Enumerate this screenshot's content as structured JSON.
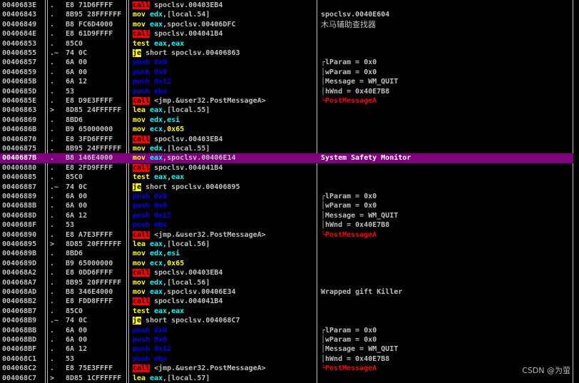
{
  "colors": {
    "background": "#000000",
    "text": "#c0c0c0",
    "selected_row": "#800080",
    "call_bg": "#ff0000",
    "call_fg": "#000000",
    "jump_bg": "#ffff00",
    "jump_fg": "#000000",
    "push": "#0000ff",
    "mov_lea": "#ffff00",
    "register": "#00ffff",
    "test": "#ffff00",
    "immediate": "#ffff00",
    "api_name": "#ff0000"
  },
  "watermark": "CSDN @为萤",
  "rows": [
    {
      "addr": "0040683E",
      "mark": ".",
      "hex": "E8 71D6FFFF",
      "mn": "call",
      "mt": "call",
      "op": "spoclsv.00403EB4",
      "cm": ""
    },
    {
      "addr": "00406843",
      "mark": ".",
      "hex": "8B95 28FFFFFF",
      "mn": "mov",
      "mt": "mov",
      "op": "edx,[local.54]",
      "cm": "spoclsv.0040E604"
    },
    {
      "addr": "00406849",
      "mark": ".",
      "hex": "B8 FC6D4000",
      "mn": "mov",
      "mt": "mov",
      "op": "eax,spoclsv.00406DFC",
      "cm": "木马辅助查找器",
      "cmt": "cn"
    },
    {
      "addr": "0040684E",
      "mark": ".",
      "hex": "E8 61D9FFFF",
      "mn": "call",
      "mt": "call",
      "op": "spoclsv.004041B4",
      "cm": ""
    },
    {
      "addr": "00406853",
      "mark": ".",
      "hex": "85C0",
      "mn": "test",
      "mt": "test",
      "op": "eax,eax",
      "cm": ""
    },
    {
      "addr": "00406855",
      "mark": ".~",
      "hex": "74 0C",
      "mn": "je",
      "mt": "jmp",
      "op": "short spoclsv.00406863",
      "cm": ""
    },
    {
      "addr": "00406857",
      "mark": ".",
      "hex": "6A 00",
      "mn": "push",
      "mt": "push",
      "op": "0x0",
      "cm": "┌lParam = 0x0"
    },
    {
      "addr": "00406859",
      "mark": ".",
      "hex": "6A 00",
      "mn": "push",
      "mt": "push",
      "op": "0x0",
      "cm": "│wParam = 0x0"
    },
    {
      "addr": "0040685B",
      "mark": ".",
      "hex": "6A 12",
      "mn": "push",
      "mt": "push",
      "op": "0x12",
      "cm": "│Message = WM_QUIT"
    },
    {
      "addr": "0040685D",
      "mark": ".",
      "hex": "53",
      "mn": "push",
      "mt": "push",
      "op": "ebx",
      "cm": "│hWnd = 0x40E7B8"
    },
    {
      "addr": "0040685E",
      "mark": ".",
      "hex": "E8 D9E3FFFF",
      "mn": "call",
      "mt": "call",
      "op": "<jmp.&user32.PostMessageA>",
      "cm": "└PostMessageA",
      "cmt": "api"
    },
    {
      "addr": "00406863",
      "mark": ">",
      "hex": "8D85 24FFFFFF",
      "mn": "lea",
      "mt": "mov",
      "op": "eax,[local.55]",
      "cm": ""
    },
    {
      "addr": "00406869",
      "mark": ".",
      "hex": "8BD6",
      "mn": "mov",
      "mt": "mov",
      "op": "edx,esi",
      "cm": ""
    },
    {
      "addr": "0040686B",
      "mark": ".",
      "hex": "B9 65000000",
      "mn": "mov",
      "mt": "mov",
      "op": "ecx,0x65",
      "cm": ""
    },
    {
      "addr": "00406870",
      "mark": ".",
      "hex": "E8 3FD6FFFF",
      "mn": "call",
      "mt": "call",
      "op": "spoclsv.00403EB4",
      "cm": ""
    },
    {
      "addr": "00406875",
      "mark": ".",
      "hex": "8B95 24FFFFFF",
      "mn": "mov",
      "mt": "mov",
      "op": "edx,[local.55]",
      "cm": ""
    },
    {
      "addr": "0040687B",
      "mark": ".",
      "hex": "B8 146E4000",
      "mn": "mov",
      "mt": "mov",
      "op": "eax,spoclsv.00406E14",
      "cm": "System Safety Monitor",
      "sel": true
    },
    {
      "addr": "00406880",
      "mark": ".",
      "hex": "E8 2FD9FFFF",
      "mn": "call",
      "mt": "call",
      "op": "spoclsv.004041B4",
      "cm": ""
    },
    {
      "addr": "00406885",
      "mark": ".",
      "hex": "85C0",
      "mn": "test",
      "mt": "test",
      "op": "eax,eax",
      "cm": ""
    },
    {
      "addr": "00406887",
      "mark": ".~",
      "hex": "74 0C",
      "mn": "je",
      "mt": "jmp",
      "op": "short spoclsv.00406895",
      "cm": ""
    },
    {
      "addr": "00406889",
      "mark": ".",
      "hex": "6A 00",
      "mn": "push",
      "mt": "push",
      "op": "0x0",
      "cm": "┌lParam = 0x0"
    },
    {
      "addr": "0040688B",
      "mark": ".",
      "hex": "6A 00",
      "mn": "push",
      "mt": "push",
      "op": "0x0",
      "cm": "│wParam = 0x0"
    },
    {
      "addr": "0040688D",
      "mark": ".",
      "hex": "6A 12",
      "mn": "push",
      "mt": "push",
      "op": "0x12",
      "cm": "│Message = WM_QUIT"
    },
    {
      "addr": "0040688F",
      "mark": ".",
      "hex": "53",
      "mn": "push",
      "mt": "push",
      "op": "ebx",
      "cm": "│hWnd = 0x40E7B8"
    },
    {
      "addr": "00406890",
      "mark": ".",
      "hex": "E8 A7E3FFFF",
      "mn": "call",
      "mt": "call",
      "op": "<jmp.&user32.PostMessageA>",
      "cm": "└PostMessageA",
      "cmt": "api"
    },
    {
      "addr": "00406895",
      "mark": ">",
      "hex": "8D85 20FFFFFF",
      "mn": "lea",
      "mt": "mov",
      "op": "eax,[local.56]",
      "cm": ""
    },
    {
      "addr": "0040689B",
      "mark": ".",
      "hex": "8BD6",
      "mn": "mov",
      "mt": "mov",
      "op": "edx,esi",
      "cm": ""
    },
    {
      "addr": "0040689D",
      "mark": ".",
      "hex": "B9 65000000",
      "mn": "mov",
      "mt": "mov",
      "op": "ecx,0x65",
      "cm": ""
    },
    {
      "addr": "004068A2",
      "mark": ".",
      "hex": "E8 0DD6FFFF",
      "mn": "call",
      "mt": "call",
      "op": "spoclsv.00403EB4",
      "cm": ""
    },
    {
      "addr": "004068A7",
      "mark": ".",
      "hex": "8B95 20FFFFFF",
      "mn": "mov",
      "mt": "mov",
      "op": "edx,[local.56]",
      "cm": ""
    },
    {
      "addr": "004068AD",
      "mark": ".",
      "hex": "B8 346E4000",
      "mn": "mov",
      "mt": "mov",
      "op": "eax,spoclsv.00406E34",
      "cm": "Wrapped gift Killer"
    },
    {
      "addr": "004068B2",
      "mark": ".",
      "hex": "E8 FDD8FFFF",
      "mn": "call",
      "mt": "call",
      "op": "spoclsv.004041B4",
      "cm": ""
    },
    {
      "addr": "004068B7",
      "mark": ".",
      "hex": "85C0",
      "mn": "test",
      "mt": "test",
      "op": "eax,eax",
      "cm": ""
    },
    {
      "addr": "004068B9",
      "mark": ".~",
      "hex": "74 0C",
      "mn": "je",
      "mt": "jmp",
      "op": "short spoclsv.004068C7",
      "cm": ""
    },
    {
      "addr": "004068BB",
      "mark": ".",
      "hex": "6A 00",
      "mn": "push",
      "mt": "push",
      "op": "0x0",
      "cm": "┌lParam = 0x0"
    },
    {
      "addr": "004068BD",
      "mark": ".",
      "hex": "6A 00",
      "mn": "push",
      "mt": "push",
      "op": "0x0",
      "cm": "│wParam = 0x0"
    },
    {
      "addr": "004068BF",
      "mark": ".",
      "hex": "6A 12",
      "mn": "push",
      "mt": "push",
      "op": "0x12",
      "cm": "│Message = WM_QUIT"
    },
    {
      "addr": "004068C1",
      "mark": ".",
      "hex": "53",
      "mn": "push",
      "mt": "push",
      "op": "ebx",
      "cm": "│hWnd = 0x40E7B8"
    },
    {
      "addr": "004068C2",
      "mark": ".",
      "hex": "E8 75E3FFFF",
      "mn": "call",
      "mt": "call",
      "op": "<jmp.&user32.PostMessageA>",
      "cm": "└PostMessageA",
      "cmt": "api"
    },
    {
      "addr": "004068C7",
      "mark": ">",
      "hex": "8D85 1CFFFFFF",
      "mn": "lea",
      "mt": "mov",
      "op": "eax,[local.57]",
      "cm": ""
    }
  ]
}
